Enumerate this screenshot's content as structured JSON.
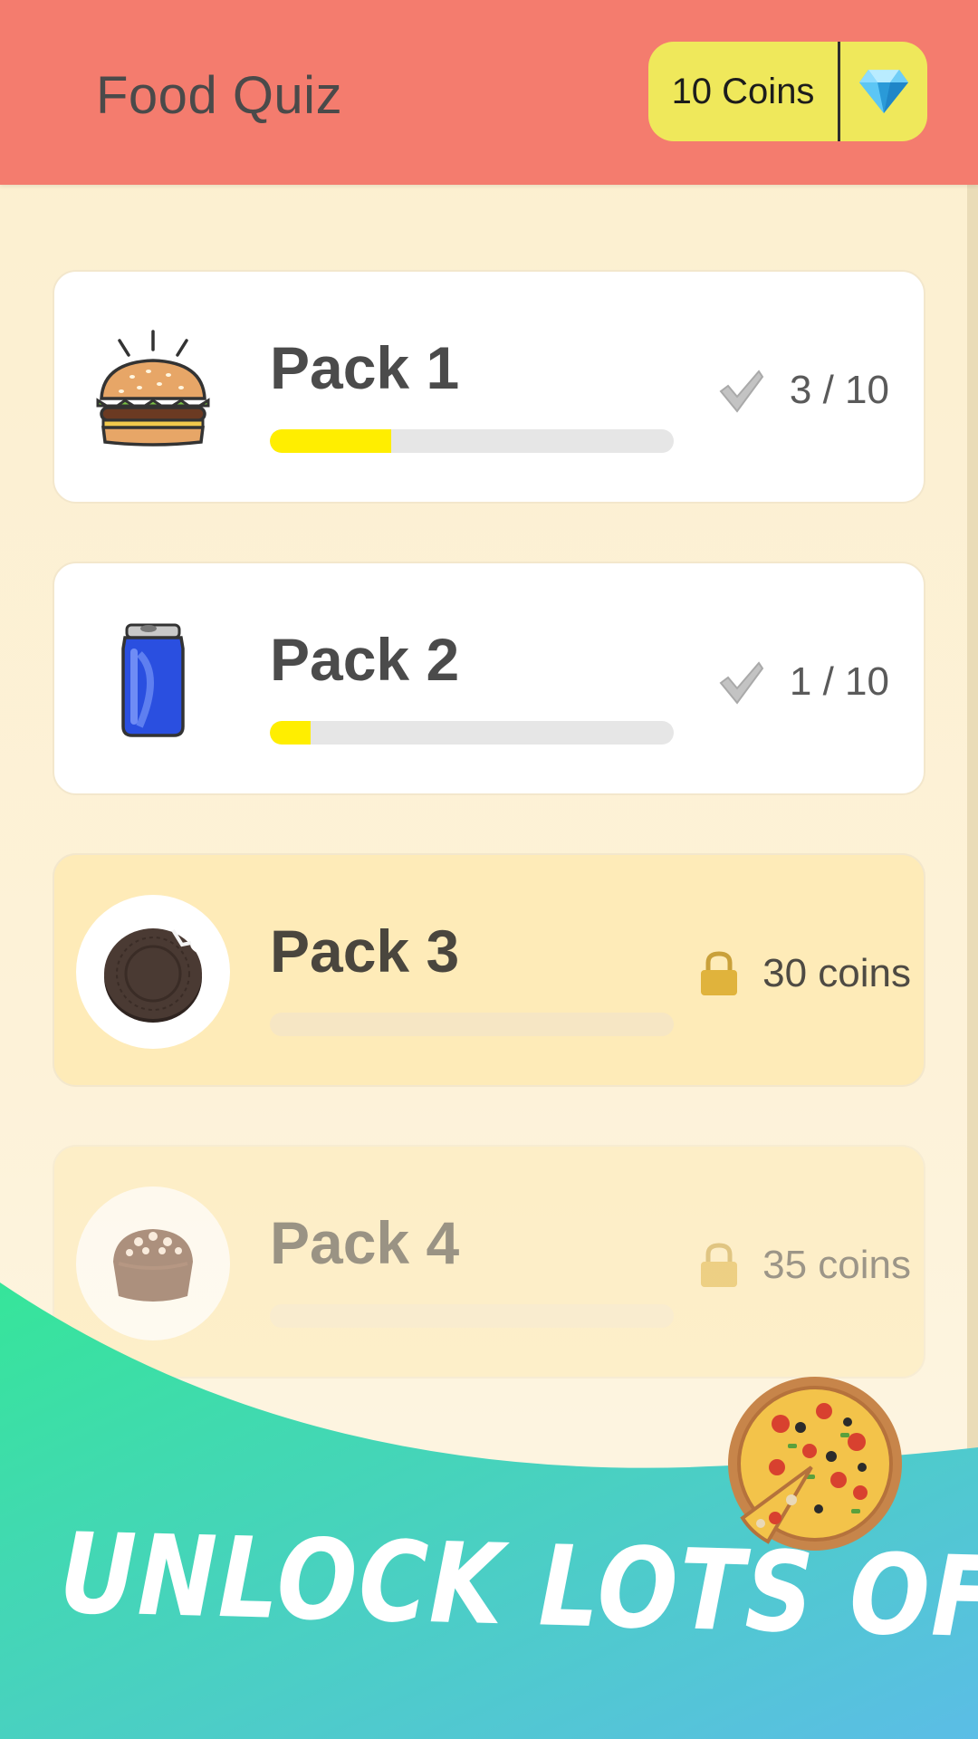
{
  "header": {
    "title": "Food Quiz",
    "coins_label": "10 Coins",
    "gem_icon": "diamond-icon",
    "background": "#f47c6e",
    "pill_color": "#efe85b"
  },
  "packs": [
    {
      "name": "Pack 1",
      "icon": "burger-icon",
      "status": "3 / 10",
      "progress": 0.3,
      "state": "unlocked"
    },
    {
      "name": "Pack 2",
      "icon": "soda-can-icon",
      "status": "1 / 10",
      "progress": 0.1,
      "state": "unlocked"
    },
    {
      "name": "Pack 3",
      "icon": "cookie-icon",
      "status": "30 coins",
      "progress": 0,
      "state": "locked"
    },
    {
      "name": "Pack 4",
      "icon": "chocolate-icon",
      "status": "35 coins",
      "progress": 0,
      "state": "locked"
    }
  ],
  "banner": {
    "text": "UNLOCK LOTS OF PACKS",
    "icon": "pizza-icon",
    "gradient_start": "#36e59a",
    "gradient_end": "#5bbde6"
  },
  "colors": {
    "progress_fill": "#ffee00",
    "lock": "#e0b33c",
    "check": "#b8b8b8"
  }
}
